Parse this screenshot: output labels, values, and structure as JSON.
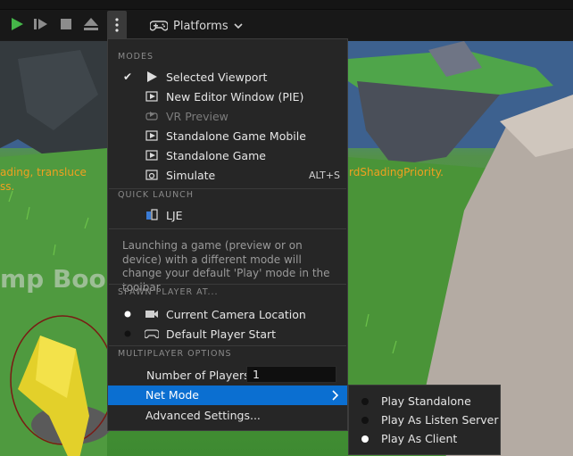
{
  "toolbar": {
    "platforms_label": "Platforms",
    "play_icon_color": "#45b649"
  },
  "viewport": {
    "overlay_left": "ading, transluce",
    "overlay_left2": "ss.",
    "overlay_right": "rdShadingPriority.",
    "sign_text": "mp Boos"
  },
  "menu": {
    "modes_header": "MODES",
    "modes": [
      {
        "label": "Selected Viewport",
        "checked": true,
        "icon": "play-icon"
      },
      {
        "label": "New Editor Window (PIE)",
        "icon": "window-play-icon"
      },
      {
        "label": "VR Preview",
        "disabled": true,
        "icon": "vr-icon"
      },
      {
        "label": "Standalone Game Mobile",
        "icon": "window-play-icon"
      },
      {
        "label": "Standalone Game",
        "icon": "window-play-icon"
      },
      {
        "label": "Simulate",
        "shortcut": "ALT+S",
        "icon": "simulate-icon"
      }
    ],
    "quick_launch_header": "QUICK LAUNCH",
    "quick_launch_item": "LJE",
    "info_text": "Launching a game (preview or on device) with a different mode will change your default 'Play' mode in the toolbar",
    "spawn_header": "SPAWN PLAYER AT...",
    "spawn": [
      {
        "label": "Current Camera Location",
        "selected": true,
        "icon": "camera-icon"
      },
      {
        "label": "Default Player Start",
        "selected": false,
        "icon": "gamepad-icon"
      }
    ],
    "multiplayer_header": "MULTIPLAYER OPTIONS",
    "players_label": "Number of Players",
    "players_value": "1",
    "net_mode_label": "Net Mode",
    "advanced_label": "Advanced Settings..."
  },
  "submenu": {
    "items": [
      {
        "label": "Play Standalone",
        "selected": false
      },
      {
        "label": "Play As Listen Server",
        "selected": false
      },
      {
        "label": "Play As Client",
        "selected": true
      }
    ]
  },
  "colors": {
    "accent": "#0b6fd1",
    "menu_bg": "#262626",
    "overlay_text": "#f0a020"
  }
}
